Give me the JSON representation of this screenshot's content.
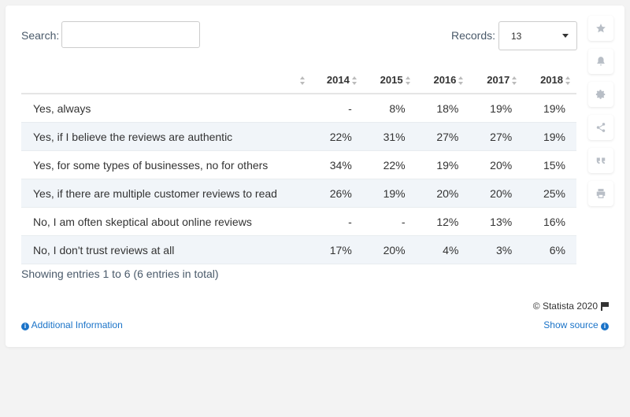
{
  "search": {
    "label": "Search:",
    "value": ""
  },
  "records": {
    "label": "Records:",
    "value": "13"
  },
  "table": {
    "columns": [
      "",
      "2014",
      "2015",
      "2016",
      "2017",
      "2018"
    ],
    "rows": [
      [
        "Yes, always",
        "-",
        "8%",
        "18%",
        "19%",
        "19%"
      ],
      [
        "Yes, if I believe the reviews are authentic",
        "22%",
        "31%",
        "27%",
        "27%",
        "19%"
      ],
      [
        "Yes, for some types of businesses, no for others",
        "34%",
        "22%",
        "19%",
        "20%",
        "15%"
      ],
      [
        "Yes, if there are multiple customer reviews to read",
        "26%",
        "19%",
        "20%",
        "20%",
        "25%"
      ],
      [
        "No, I am often skeptical about online reviews",
        "-",
        "-",
        "12%",
        "13%",
        "16%"
      ],
      [
        "No, I don't trust reviews at all",
        "17%",
        "20%",
        "4%",
        "3%",
        "6%"
      ]
    ]
  },
  "footer": {
    "showing": "Showing entries 1 to 6 (6 entries in total)",
    "copyright": "© Statista 2020",
    "additional_info": "Additional Information",
    "show_source": "Show source"
  },
  "sidebar_icons": [
    "star-icon",
    "bell-icon",
    "gear-icon",
    "share-icon",
    "quote-icon",
    "print-icon"
  ],
  "colors": {
    "link": "#1a73c8",
    "row_alt": "#f1f5f9",
    "icon": "#b8bec6"
  },
  "chart_data": {
    "type": "table",
    "categories": [
      "2014",
      "2015",
      "2016",
      "2017",
      "2018"
    ],
    "series": [
      {
        "name": "Yes, always",
        "values": [
          null,
          8,
          18,
          19,
          19
        ]
      },
      {
        "name": "Yes, if I believe the reviews are authentic",
        "values": [
          22,
          31,
          27,
          27,
          19
        ]
      },
      {
        "name": "Yes, for some types of businesses, no for others",
        "values": [
          34,
          22,
          19,
          20,
          15
        ]
      },
      {
        "name": "Yes, if there are multiple customer reviews to read",
        "values": [
          26,
          19,
          20,
          20,
          25
        ]
      },
      {
        "name": "No, I am often skeptical about online reviews",
        "values": [
          null,
          null,
          12,
          13,
          16
        ]
      },
      {
        "name": "No, I don't trust reviews at all",
        "values": [
          17,
          20,
          4,
          3,
          6
        ]
      }
    ]
  }
}
